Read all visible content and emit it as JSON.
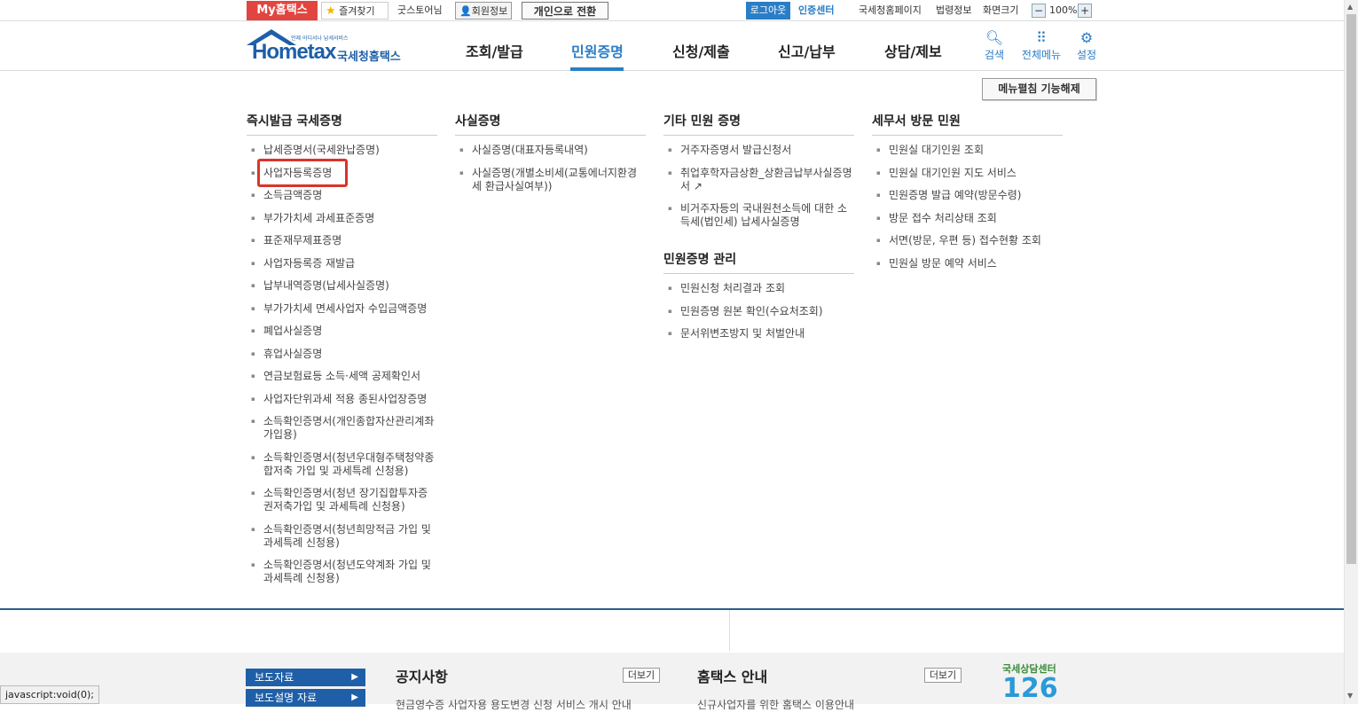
{
  "topbar": {
    "my_hometax": "My홈택스",
    "bookmark": "즐겨찾기",
    "user_name": "굿스토어님",
    "member_info": "회원정보",
    "switch_personal": "개인으로 전환",
    "logout": "로그아웃",
    "cert_center": "인증센터",
    "nts_page": "국세청홈페이지",
    "law_info": "법령정보",
    "zoom_label": "화면크기",
    "zoom_out": "−",
    "zoom_value": "100%",
    "zoom_in": "+"
  },
  "logo": {
    "main": "Hometax",
    "kor": "국세청홈택스",
    "tagline": "언제 어디서나 납세서비스"
  },
  "gnb": {
    "items": [
      "조회/발급",
      "민원증명",
      "신청/제출",
      "신고/납부",
      "상담/제보"
    ],
    "active": "민원증명"
  },
  "header_icons": {
    "search": "검색",
    "all_menu": "전체메뉴",
    "settings": "설정"
  },
  "menu_close": "메뉴펼침 기능해제",
  "columns": [
    {
      "title": "즉시발급 국세증명",
      "items": [
        "납세증명서(국세완납증명)",
        "사업자등록증명",
        "소득금액증명",
        "부가가치세 과세표준증명",
        "표준재무제표증명",
        "사업자등록증 재발급",
        "납부내역증명(납세사실증명)",
        "부가가치세 면세사업자 수입금액증명",
        "폐업사실증명",
        "휴업사실증명",
        "연금보험료등 소득·세액 공제확인서",
        "사업자단위과세 적용 종된사업장증명",
        "소득확인증명서(개인종합자산관리계좌 가입용)",
        "소득확인증명서(청년우대형주택청약종합저축 가입 및 과세특례 신청용)",
        "소득확인증명서(청년 장기집합투자증권저축가입 및 과세특례 신청용)",
        "소득확인증명서(청년희망적금 가입 및 과세특례 신청용)",
        "소득확인증명서(청년도약계좌 가입 및 과세특례 신청용)"
      ]
    },
    {
      "title": "사실증명",
      "items": [
        "사실증명(대표자등록내역)",
        "사실증명(개별소비세(교통에너지환경세 환급사실여부))"
      ]
    },
    {
      "title": "기타 민원 증명",
      "items": [
        "거주자증명서 발급신청서",
        "취업후학자금상환_상환금납부사실증명서",
        "비거주자등의 국내원천소득에 대한 소득세(법인세) 납세사실증명"
      ],
      "title2": "민원증명 관리",
      "items2": [
        "민원신청 처리결과 조회",
        "민원증명 원본 확인(수요처조회)",
        "문서위변조방지 및 처벌안내"
      ]
    },
    {
      "title": "세무서 방문 민원",
      "items": [
        "민원실 대기인원 조회",
        "민원실 대기인원 지도 서비스",
        "민원증명 발급 예약(방문수령)",
        "방문 접수 처리상태 조회",
        "서면(방문, 우편 등) 접수현황 조회",
        "민원실 방문 예약 서비스"
      ]
    }
  ],
  "footer": {
    "press1": "보도자료",
    "press2": "보도설명 자료",
    "notice_title": "공지사항",
    "notice_more": "더보기",
    "notice_item": "현금영수증 사업자용 용도변경 신청 서비스 개시 안내",
    "guide_title": "홈택스 안내",
    "guide_more": "더보기",
    "guide_item": "신규사업자를 위한 홈택스 이용안내",
    "call_center_label": "국세상담센터",
    "call_center_number": "126"
  },
  "status_bar": "javascript:void(0);"
}
